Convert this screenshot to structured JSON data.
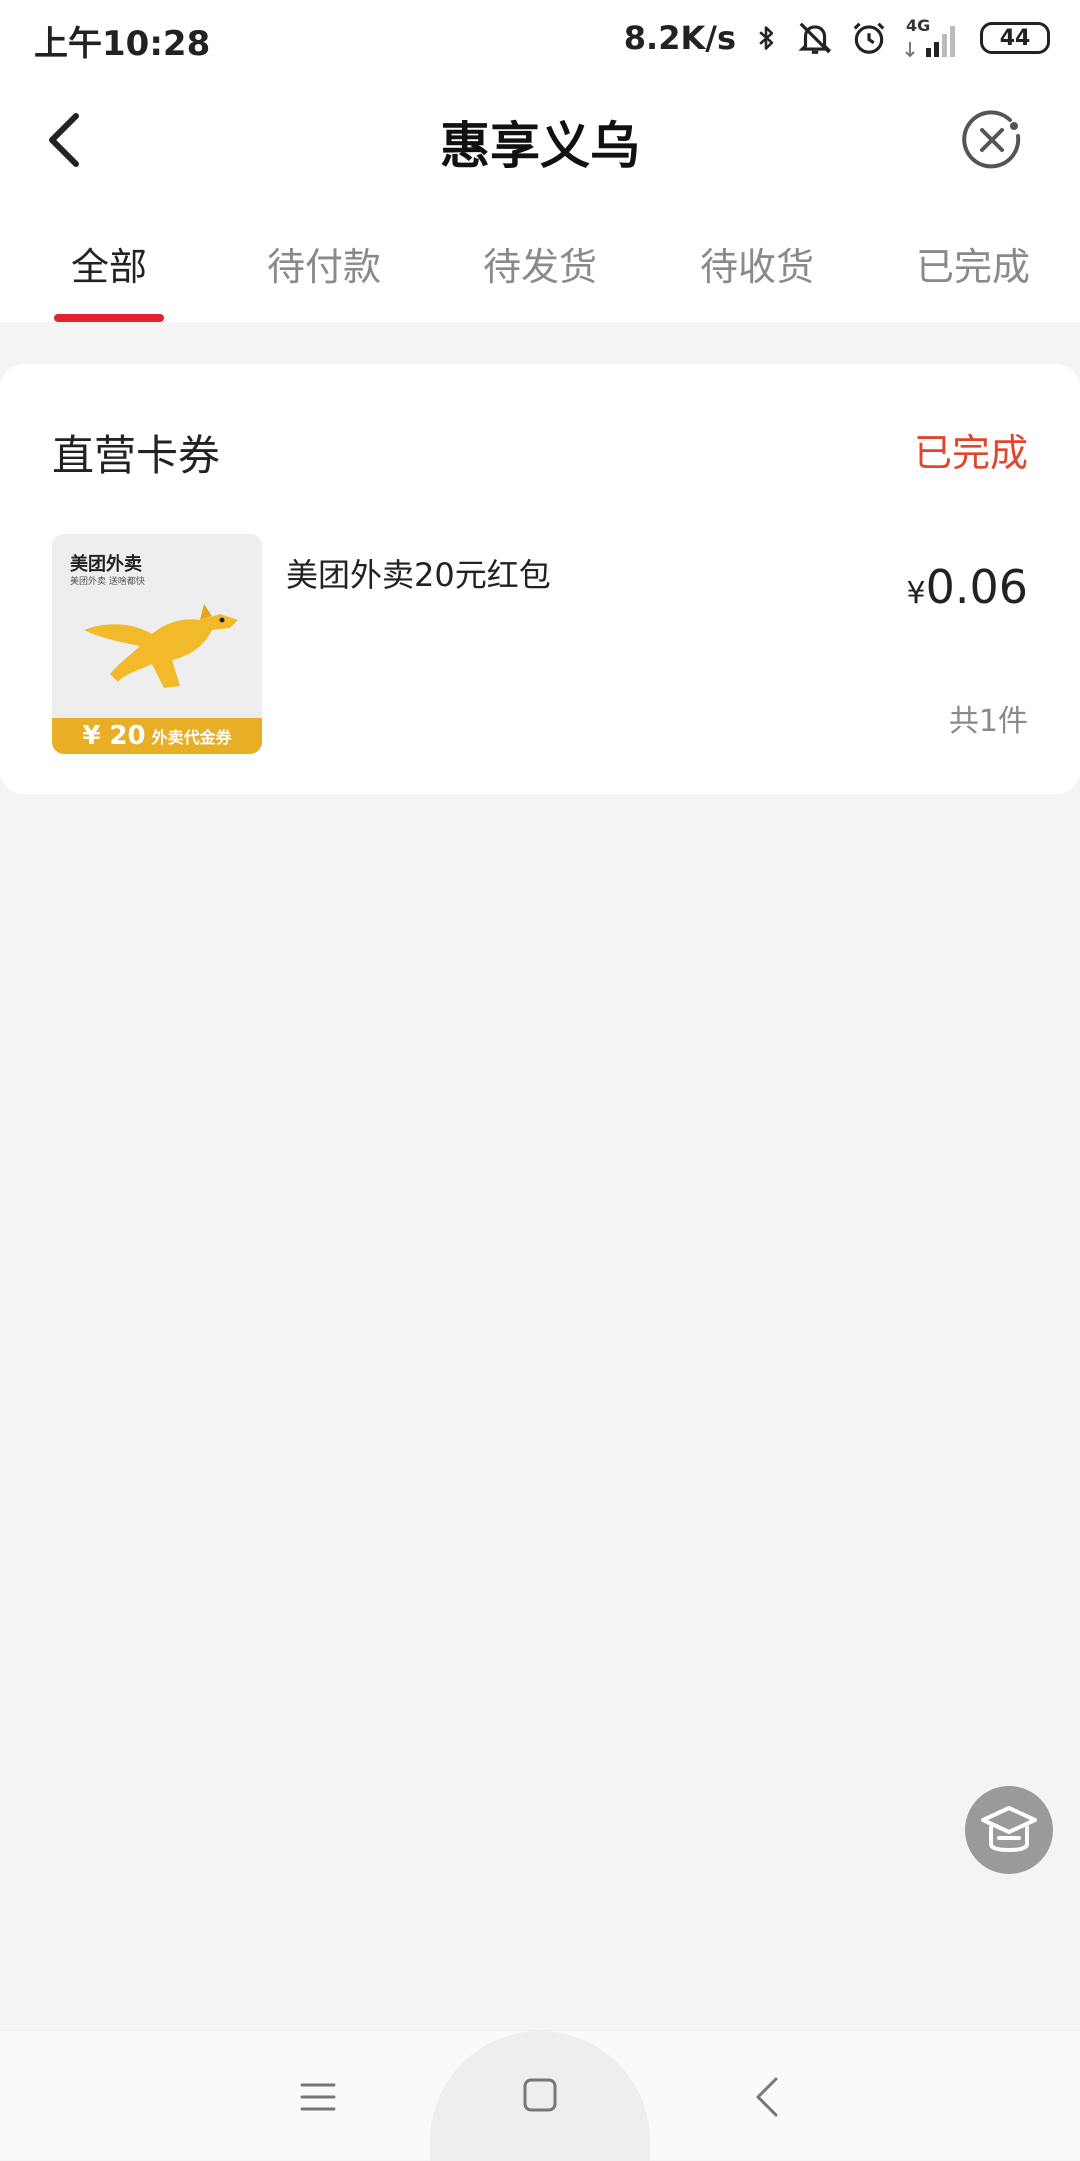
{
  "status_bar": {
    "time": "上午10:28",
    "net_speed": "8.2K/s",
    "network_type": "4G",
    "battery": "44",
    "icons": [
      "bluetooth-icon",
      "mute-icon",
      "alarm-icon",
      "signal-icon",
      "battery-icon"
    ]
  },
  "header": {
    "title": "惠享义乌",
    "back_icon": "chevron-left-icon",
    "close_icon": "close-circle-icon"
  },
  "tabs": [
    {
      "label": "全部",
      "active": true
    },
    {
      "label": "待付款",
      "active": false
    },
    {
      "label": "待发货",
      "active": false
    },
    {
      "label": "待收货",
      "active": false
    },
    {
      "label": "已完成",
      "active": false
    }
  ],
  "order": {
    "shop_name": "直营卡券",
    "status": "已完成",
    "product": {
      "name": "美团外卖20元红包",
      "price_symbol": "¥",
      "price": "0.06",
      "quantity": "共1件",
      "thumbnail": {
        "brand": "美团外卖",
        "tagline": "美团外卖 送啥都快",
        "banner_amount": "¥ 20",
        "banner_label": "外卖代金券"
      }
    }
  },
  "colors": {
    "accent_red": "#e3212f",
    "status_orange": "#e0462d",
    "thumbnail_gold": "#e8ae25"
  },
  "nav_bar": {
    "icons": [
      "menu-icon",
      "home-square-icon",
      "nav-back-icon"
    ]
  }
}
